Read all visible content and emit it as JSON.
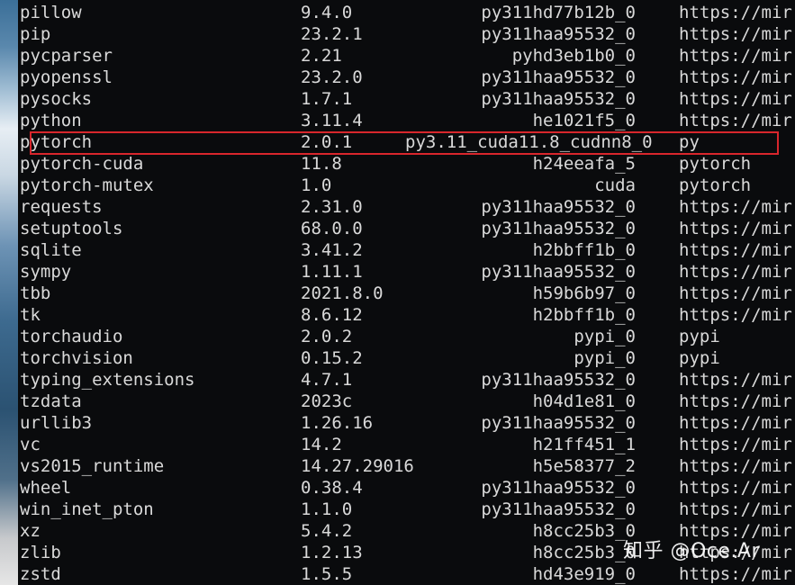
{
  "packages": [
    {
      "name": "pillow",
      "version": "9.4.0",
      "build": "py311hd77b12b_0",
      "channel": "https://mir"
    },
    {
      "name": "pip",
      "version": "23.2.1",
      "build": "py311haa95532_0",
      "channel": "https://mir"
    },
    {
      "name": "pycparser",
      "version": "2.21",
      "build": "pyhd3eb1b0_0",
      "channel": "https://mir"
    },
    {
      "name": "pyopenssl",
      "version": "23.2.0",
      "build": "py311haa95532_0",
      "channel": "https://mir"
    },
    {
      "name": "pysocks",
      "version": "1.7.1",
      "build": "py311haa95532_0",
      "channel": "https://mir"
    },
    {
      "name": "python",
      "version": "3.11.4",
      "build": "he1021f5_0",
      "channel": "https://mir"
    },
    {
      "name": "pytorch",
      "version": "2.0.1",
      "build": "py3.11_cuda11.8_cudnn8_0",
      "channel": "py"
    },
    {
      "name": "pytorch-cuda",
      "version": "11.8",
      "build": "h24eeafa_5",
      "channel": "pytorch"
    },
    {
      "name": "pytorch-mutex",
      "version": "1.0",
      "build": "cuda",
      "channel": "pytorch"
    },
    {
      "name": "requests",
      "version": "2.31.0",
      "build": "py311haa95532_0",
      "channel": "https://mir"
    },
    {
      "name": "setuptools",
      "version": "68.0.0",
      "build": "py311haa95532_0",
      "channel": "https://mir"
    },
    {
      "name": "sqlite",
      "version": "3.41.2",
      "build": "h2bbff1b_0",
      "channel": "https://mir"
    },
    {
      "name": "sympy",
      "version": "1.11.1",
      "build": "py311haa95532_0",
      "channel": "https://mir"
    },
    {
      "name": "tbb",
      "version": "2021.8.0",
      "build": "h59b6b97_0",
      "channel": "https://mir"
    },
    {
      "name": "tk",
      "version": "8.6.12",
      "build": "h2bbff1b_0",
      "channel": "https://mir"
    },
    {
      "name": "torchaudio",
      "version": "2.0.2",
      "build": "pypi_0",
      "channel": "pypi"
    },
    {
      "name": "torchvision",
      "version": "0.15.2",
      "build": "pypi_0",
      "channel": "pypi"
    },
    {
      "name": "typing_extensions",
      "version": "4.7.1",
      "build": "py311haa95532_0",
      "channel": "https://mir"
    },
    {
      "name": "tzdata",
      "version": "2023c",
      "build": "h04d1e81_0",
      "channel": "https://mir"
    },
    {
      "name": "urllib3",
      "version": "1.26.16",
      "build": "py311haa95532_0",
      "channel": "https://mir"
    },
    {
      "name": "vc",
      "version": "14.2",
      "build": "h21ff451_1",
      "channel": "https://mir"
    },
    {
      "name": "vs2015_runtime",
      "version": "14.27.29016",
      "build": "h5e58377_2",
      "channel": "https://mir"
    },
    {
      "name": "wheel",
      "version": "0.38.4",
      "build": "py311haa95532_0",
      "channel": "https://mir"
    },
    {
      "name": "win_inet_pton",
      "version": "1.1.0",
      "build": "py311haa95532_0",
      "channel": "https://mir"
    },
    {
      "name": "xz",
      "version": "5.4.2",
      "build": "h8cc25b3_0",
      "channel": "https://mir"
    },
    {
      "name": "zlib",
      "version": "1.2.13",
      "build": "h8cc25b3_0",
      "channel": "https://mir"
    },
    {
      "name": "zstd",
      "version": "1.5.5",
      "build": "hd43e919_0",
      "channel": "https://mir"
    }
  ],
  "highlighted_package": "pytorch",
  "watermark": "知乎 @Oce.Ar",
  "colors": {
    "background": "#0a0b0d",
    "text": "#d9d9d9",
    "highlight_border": "#d8262c"
  }
}
